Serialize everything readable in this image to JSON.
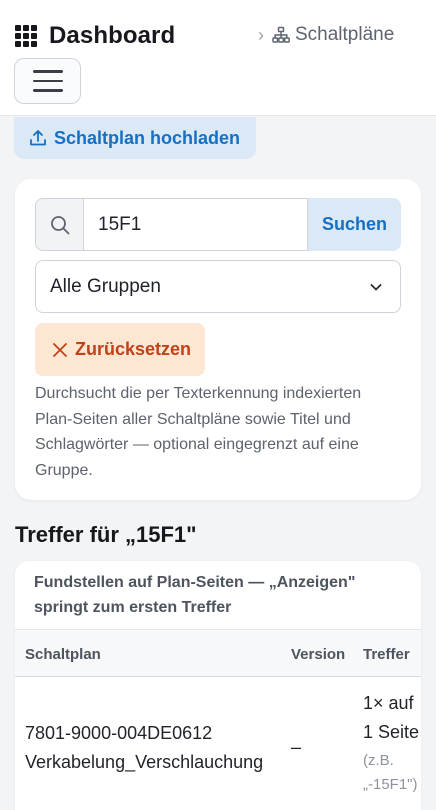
{
  "header": {
    "title": "Dashboard",
    "breadcrumb": "Schaltpläne"
  },
  "upload": {
    "label": "Schaltplan hochladen"
  },
  "search": {
    "query": "15F1",
    "button_label": "Suchen",
    "group_selected": "Alle Gruppen",
    "reset_label": "Zurücksetzen",
    "help_line1": "Durchsucht die per Texterkennung indexierten",
    "help_line2": "Plan-Seiten aller Schaltpläne sowie Titel und",
    "help_line3": "Schlagwörter — optional eingegrenzt auf eine",
    "help_line4": "Gruppe."
  },
  "results": {
    "title": "Treffer für „15F1\"",
    "caption_line1": "Fundstellen auf Plan-Seiten — „Anzeigen\"",
    "caption_line2": "springt zum ersten Treffer",
    "columns": {
      "plan": "Schaltplan",
      "version": "Version",
      "hits": "Treffer"
    },
    "rows": [
      {
        "plan_line1": "7801-9000-004DE0612",
        "plan_line2": "Verkabelung_Verschlauchung",
        "version": "–",
        "hits_line1": "1× auf",
        "hits_line2": "1 Seite",
        "hits_example1": "(z.B.",
        "hits_example2": "„-15F1\")"
      }
    ]
  },
  "colors": {
    "accent": "#1570c4",
    "accent_bg": "#dbe8f6",
    "danger": "#c0411a",
    "danger_bg": "#fde7d3",
    "page_bg": "#f3f4f6"
  },
  "icons": {
    "brand": "grid-icon",
    "breadcrumb": "sitemap-icon",
    "menu": "hamburger-icon",
    "upload": "upload-icon",
    "search": "search-icon",
    "select": "chevron-down-icon",
    "reset": "close-icon"
  }
}
